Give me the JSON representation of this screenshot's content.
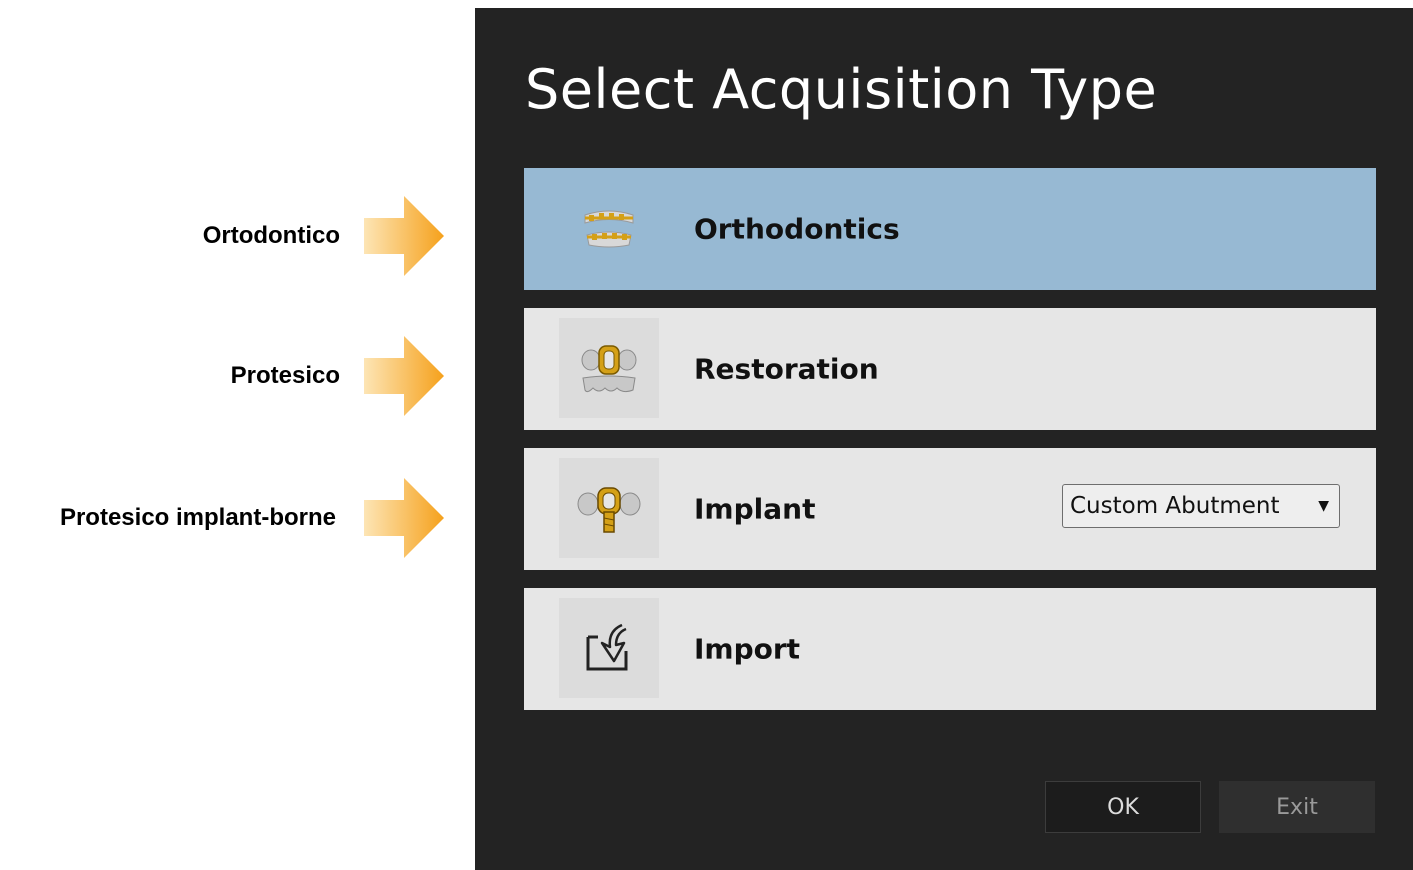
{
  "annotations": [
    {
      "label": "Ortodontico"
    },
    {
      "label": "Protesico"
    },
    {
      "label": "Protesico implant-borne"
    }
  ],
  "dialog": {
    "title": "Select Acquisition Type",
    "options": [
      {
        "label": "Orthodontics",
        "icon": "orthodontics-braces-icon",
        "selected": true
      },
      {
        "label": "Restoration",
        "icon": "restoration-crown-icon",
        "selected": false
      },
      {
        "label": "Implant",
        "icon": "implant-abutment-icon",
        "selected": false,
        "dropdown_value": "Custom Abutment"
      },
      {
        "label": "Import",
        "icon": "import-arrow-icon",
        "selected": false
      }
    ],
    "ok_label": "OK",
    "exit_label": "Exit"
  },
  "colors": {
    "dialog_bg": "#232323",
    "selected_option": "#97b9d3",
    "option_bg": "#e6e6e6",
    "arrow_orange": "#f7a823",
    "icon_gold": "#d4a017"
  }
}
